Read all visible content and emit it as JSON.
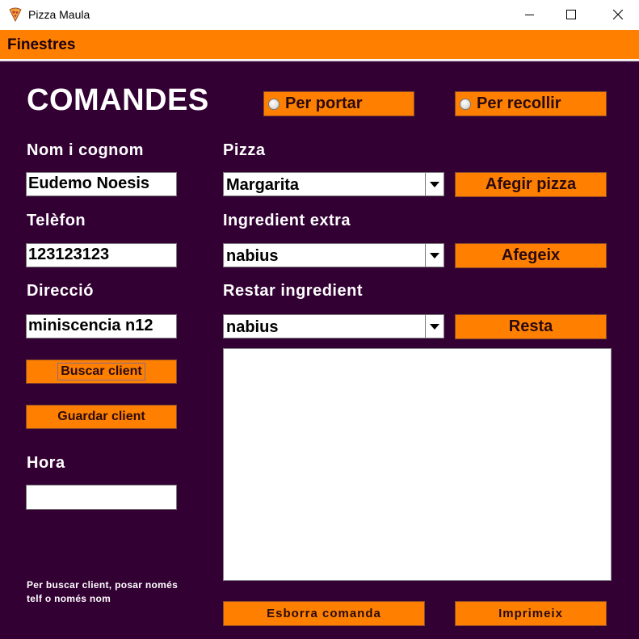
{
  "window": {
    "title": "Pizza Maula",
    "icon": "pizza-slice-icon"
  },
  "menu": {
    "items": [
      "Finestres"
    ]
  },
  "form": {
    "heading": "COMANDES",
    "delivery_options": {
      "carry": "Per portar",
      "pickup": "Per recollir"
    },
    "labels": {
      "name": "Nom i cognom",
      "phone": "Telèfon",
      "address": "Direcció",
      "time": "Hora",
      "pizza": "Pizza",
      "extra_ingredient": "Ingredient extra",
      "remove_ingredient": "Restar ingredient"
    },
    "values": {
      "name": "Eudemo Noesis",
      "phone": "123123123",
      "address": "miniscencia n12",
      "time": ""
    },
    "selects": {
      "pizza": "Margarita",
      "extra_ingredient": "nabius",
      "remove_ingredient": "nabius"
    },
    "buttons": {
      "search_client": "Buscar client",
      "save_client": "Guardar client",
      "add_pizza": "Afegir pizza",
      "add": "Afegeix",
      "subtract": "Resta",
      "clear_order": "Esborra comanda",
      "print": "Imprimeix"
    },
    "note_line1": "Per buscar client, posar només",
    "note_line2": "telf o només nom",
    "order_text": ""
  },
  "colors": {
    "panel": "#330033",
    "accent": "#ff8000",
    "text_light": "#ffffff"
  }
}
